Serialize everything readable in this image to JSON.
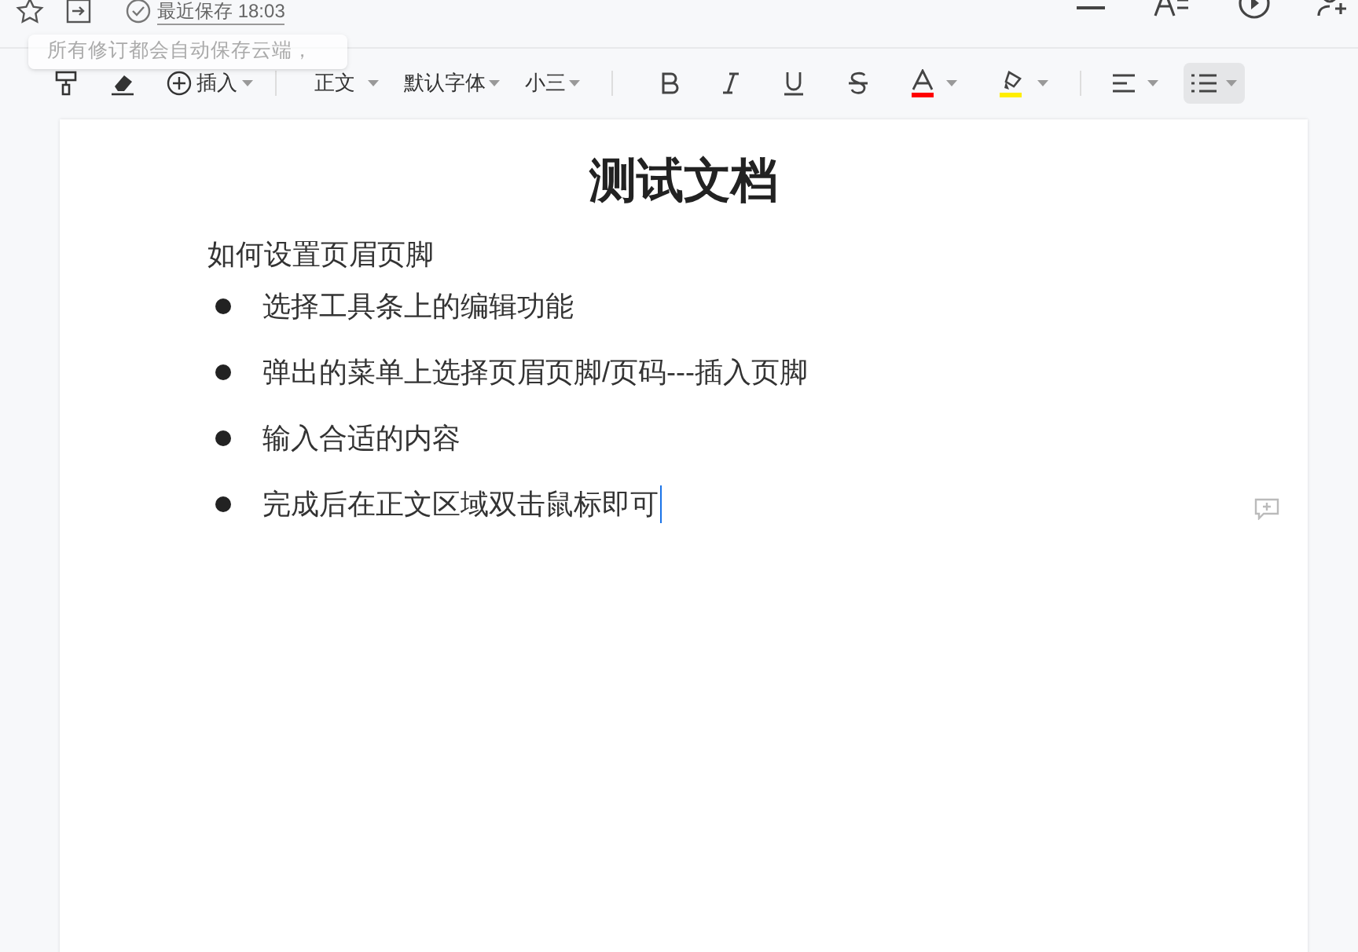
{
  "header": {
    "save_status": "最近保存 18:03"
  },
  "tooltip": {
    "lines": [
      "所有修订都会自动保存云端，"
    ]
  },
  "toolbar": {
    "insert": "插入",
    "style": "正文",
    "font": "默认字体",
    "size": "小三",
    "list_selected": true
  },
  "document": {
    "title": "测试文档",
    "paragraph": "如何设置页眉页脚",
    "bullets": [
      "选择工具条上的编辑功能",
      "弹出的菜单上选择页眉页脚/页码---插入页脚",
      "输入合适的内容",
      "完成后在正文区域双击鼠标即可"
    ]
  }
}
